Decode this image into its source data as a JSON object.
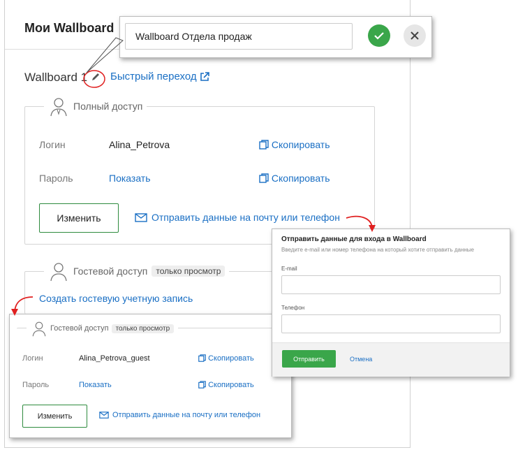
{
  "header": {
    "title": "Мои Wallboard"
  },
  "rename_popup": {
    "value": "Wallboard Отдела продаж"
  },
  "wallboard": {
    "name": "Wallboard 1",
    "quick_link": "Быстрый переход"
  },
  "full_access": {
    "legend": "Полный доступ",
    "login_label": "Логин",
    "login_value": "Alina_Petrova",
    "password_label": "Пароль",
    "password_value": "Показать",
    "copy": "Скопировать",
    "edit_button": "Изменить",
    "send_link": "Отправить данные на почту или телефон"
  },
  "guest_access": {
    "legend": "Гостевой доступ",
    "badge": "только просмотр",
    "create_link": "Создать гостевую учетную запись"
  },
  "guest_panel": {
    "legend": "Гостевой доступ",
    "badge": "только просмотр",
    "login_label": "Логин",
    "login_value": "Alina_Petrova_guest",
    "password_label": "Пароль",
    "password_value": "Показать",
    "copy": "Скопировать",
    "edit_button": "Изменить",
    "send_link": "Отправить данные на почту или телефон"
  },
  "send_dialog": {
    "title": "Отправить данные для входа в Wallboard",
    "subtitle": "Введите e-mail или номер телефона на который хотите отправить данные",
    "email_label": "E-mail",
    "phone_label": "Телефон",
    "submit": "Отправить",
    "cancel": "Отмена"
  },
  "colors": {
    "accent_green": "#3aa64a",
    "link_blue": "#1a6fc4",
    "annotation_red": "#e02020"
  }
}
